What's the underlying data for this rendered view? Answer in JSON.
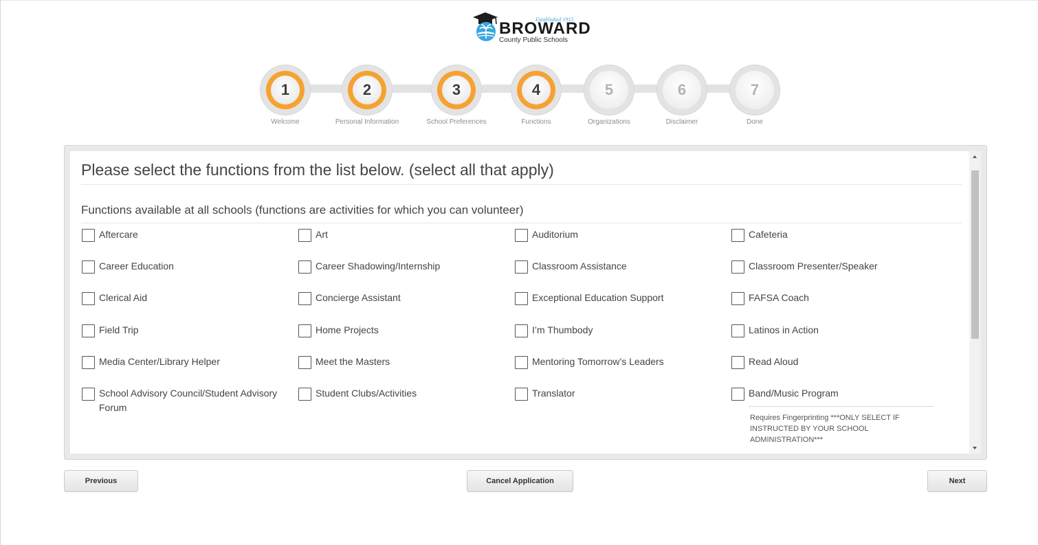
{
  "logo": {
    "established": "Established 1915",
    "wordmark": "BROWARD",
    "subtitle": "County Public Schools"
  },
  "stepper": {
    "steps": [
      {
        "number": "1",
        "label": "Welcome",
        "state": "complete"
      },
      {
        "number": "2",
        "label": "Personal Information",
        "state": "complete"
      },
      {
        "number": "3",
        "label": "School Preferences",
        "state": "complete"
      },
      {
        "number": "4",
        "label": "Functions",
        "state": "current"
      },
      {
        "number": "5",
        "label": "Organizations",
        "state": "incomplete"
      },
      {
        "number": "6",
        "label": "Disclaimer",
        "state": "incomplete"
      },
      {
        "number": "7",
        "label": "Done",
        "state": "incomplete"
      }
    ],
    "active_color": "#f6a230"
  },
  "form": {
    "heading": "Please select the functions from the list below. (select all that apply)",
    "subheading": "Functions available at all schools (functions are activities for which you can volunteer)",
    "options": [
      {
        "label": "Aftercare",
        "checked": false
      },
      {
        "label": "Art",
        "checked": false
      },
      {
        "label": "Auditorium",
        "checked": false
      },
      {
        "label": "Cafeteria",
        "checked": false
      },
      {
        "label": "Career Education",
        "checked": false
      },
      {
        "label": "Career Shadowing/Internship",
        "checked": false
      },
      {
        "label": "Classroom Assistance",
        "checked": false
      },
      {
        "label": "Classroom Presenter/Speaker",
        "checked": false
      },
      {
        "label": "Clerical Aid",
        "checked": false
      },
      {
        "label": "Concierge Assistant",
        "checked": false
      },
      {
        "label": "Exceptional Education Support",
        "checked": false
      },
      {
        "label": "FAFSA Coach",
        "checked": false
      },
      {
        "label": "Field Trip",
        "checked": false
      },
      {
        "label": "Home Projects",
        "checked": false
      },
      {
        "label": "I’m Thumbody",
        "checked": false
      },
      {
        "label": "Latinos in Action",
        "checked": false
      },
      {
        "label": "Media Center/Library Helper",
        "checked": false
      },
      {
        "label": "Meet the Masters",
        "checked": false
      },
      {
        "label": "Mentoring Tomorrow’s Leaders",
        "checked": false
      },
      {
        "label": "Read Aloud",
        "checked": false
      },
      {
        "label": "School Advisory Council/Student Advisory Forum",
        "checked": false
      },
      {
        "label": "Student Clubs/Activities",
        "checked": false
      },
      {
        "label": "Translator",
        "checked": false
      },
      {
        "label": "Band/Music Program",
        "checked": false
      }
    ],
    "band_note": "Requires Fingerprinting ***ONLY SELECT IF INSTRUCTED BY YOUR SCHOOL ADMINISTRATION***"
  },
  "buttons": {
    "previous": "Previous",
    "cancel": "Cancel Application",
    "next": "Next"
  }
}
